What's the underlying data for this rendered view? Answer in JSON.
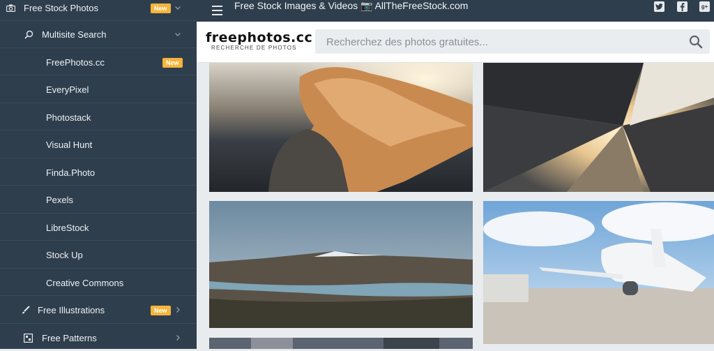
{
  "sidebar": {
    "items": [
      {
        "label": "Free Stock Photos",
        "badge": "New",
        "icon": "camera-icon"
      },
      {
        "label": "Multisite Search",
        "icon": "search-icon"
      },
      {
        "label": "FreePhotos.cc",
        "badge": "New"
      },
      {
        "label": "EveryPixel"
      },
      {
        "label": "Photostack"
      },
      {
        "label": "Visual Hunt"
      },
      {
        "label": "Finda.Photo"
      },
      {
        "label": "Pexels"
      },
      {
        "label": "LibreStock"
      },
      {
        "label": "Stock Up"
      },
      {
        "label": "Creative Commons"
      },
      {
        "label": "Free Illustrations",
        "badge": "New",
        "icon": "brush-icon"
      },
      {
        "label": "Free Patterns",
        "icon": "pattern-icon"
      }
    ]
  },
  "topbar": {
    "title": "Free Stock Images & Videos 📷 AllTheFreeStock.com",
    "social": [
      "twitter-icon",
      "facebook-icon",
      "google-plus-icon"
    ]
  },
  "header": {
    "logo_main": "freephotos.cc",
    "logo_sub": "RECHERCHE DE PHOTOS",
    "search_placeholder": "Recherchez des photos gratuites..."
  },
  "colors": {
    "sidebar_bg": "#2f3e4d",
    "badge": "#f5b53a",
    "accent_text": "#ffffff"
  }
}
